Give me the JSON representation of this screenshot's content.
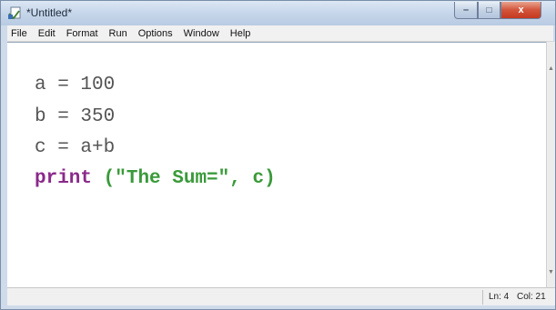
{
  "window": {
    "title": "*Untitled*",
    "controls": {
      "minimize": "–",
      "maximize": "□",
      "close": "x"
    }
  },
  "menu": [
    "File",
    "Edit",
    "Format",
    "Run",
    "Options",
    "Window",
    "Help"
  ],
  "editor": {
    "lines": [
      {
        "text": "a = 100"
      },
      {
        "text": "b = 350"
      },
      {
        "text": "c = a+b"
      },
      {
        "keyword": "print",
        "rest_open": " (",
        "string": "\"The Sum=\"",
        "rest_close": ", c)"
      }
    ]
  },
  "status": {
    "line": "Ln: 4",
    "col": "Col: 21"
  },
  "colors": {
    "keyword": "#8a2a8a",
    "string": "#3a9a3a",
    "code": "#555555",
    "close_button": "#c4391f"
  },
  "icons": {
    "app": "idle-document-icon",
    "scroll_up": "scroll-up-arrow-icon",
    "scroll_down": "scroll-down-arrow-icon"
  }
}
